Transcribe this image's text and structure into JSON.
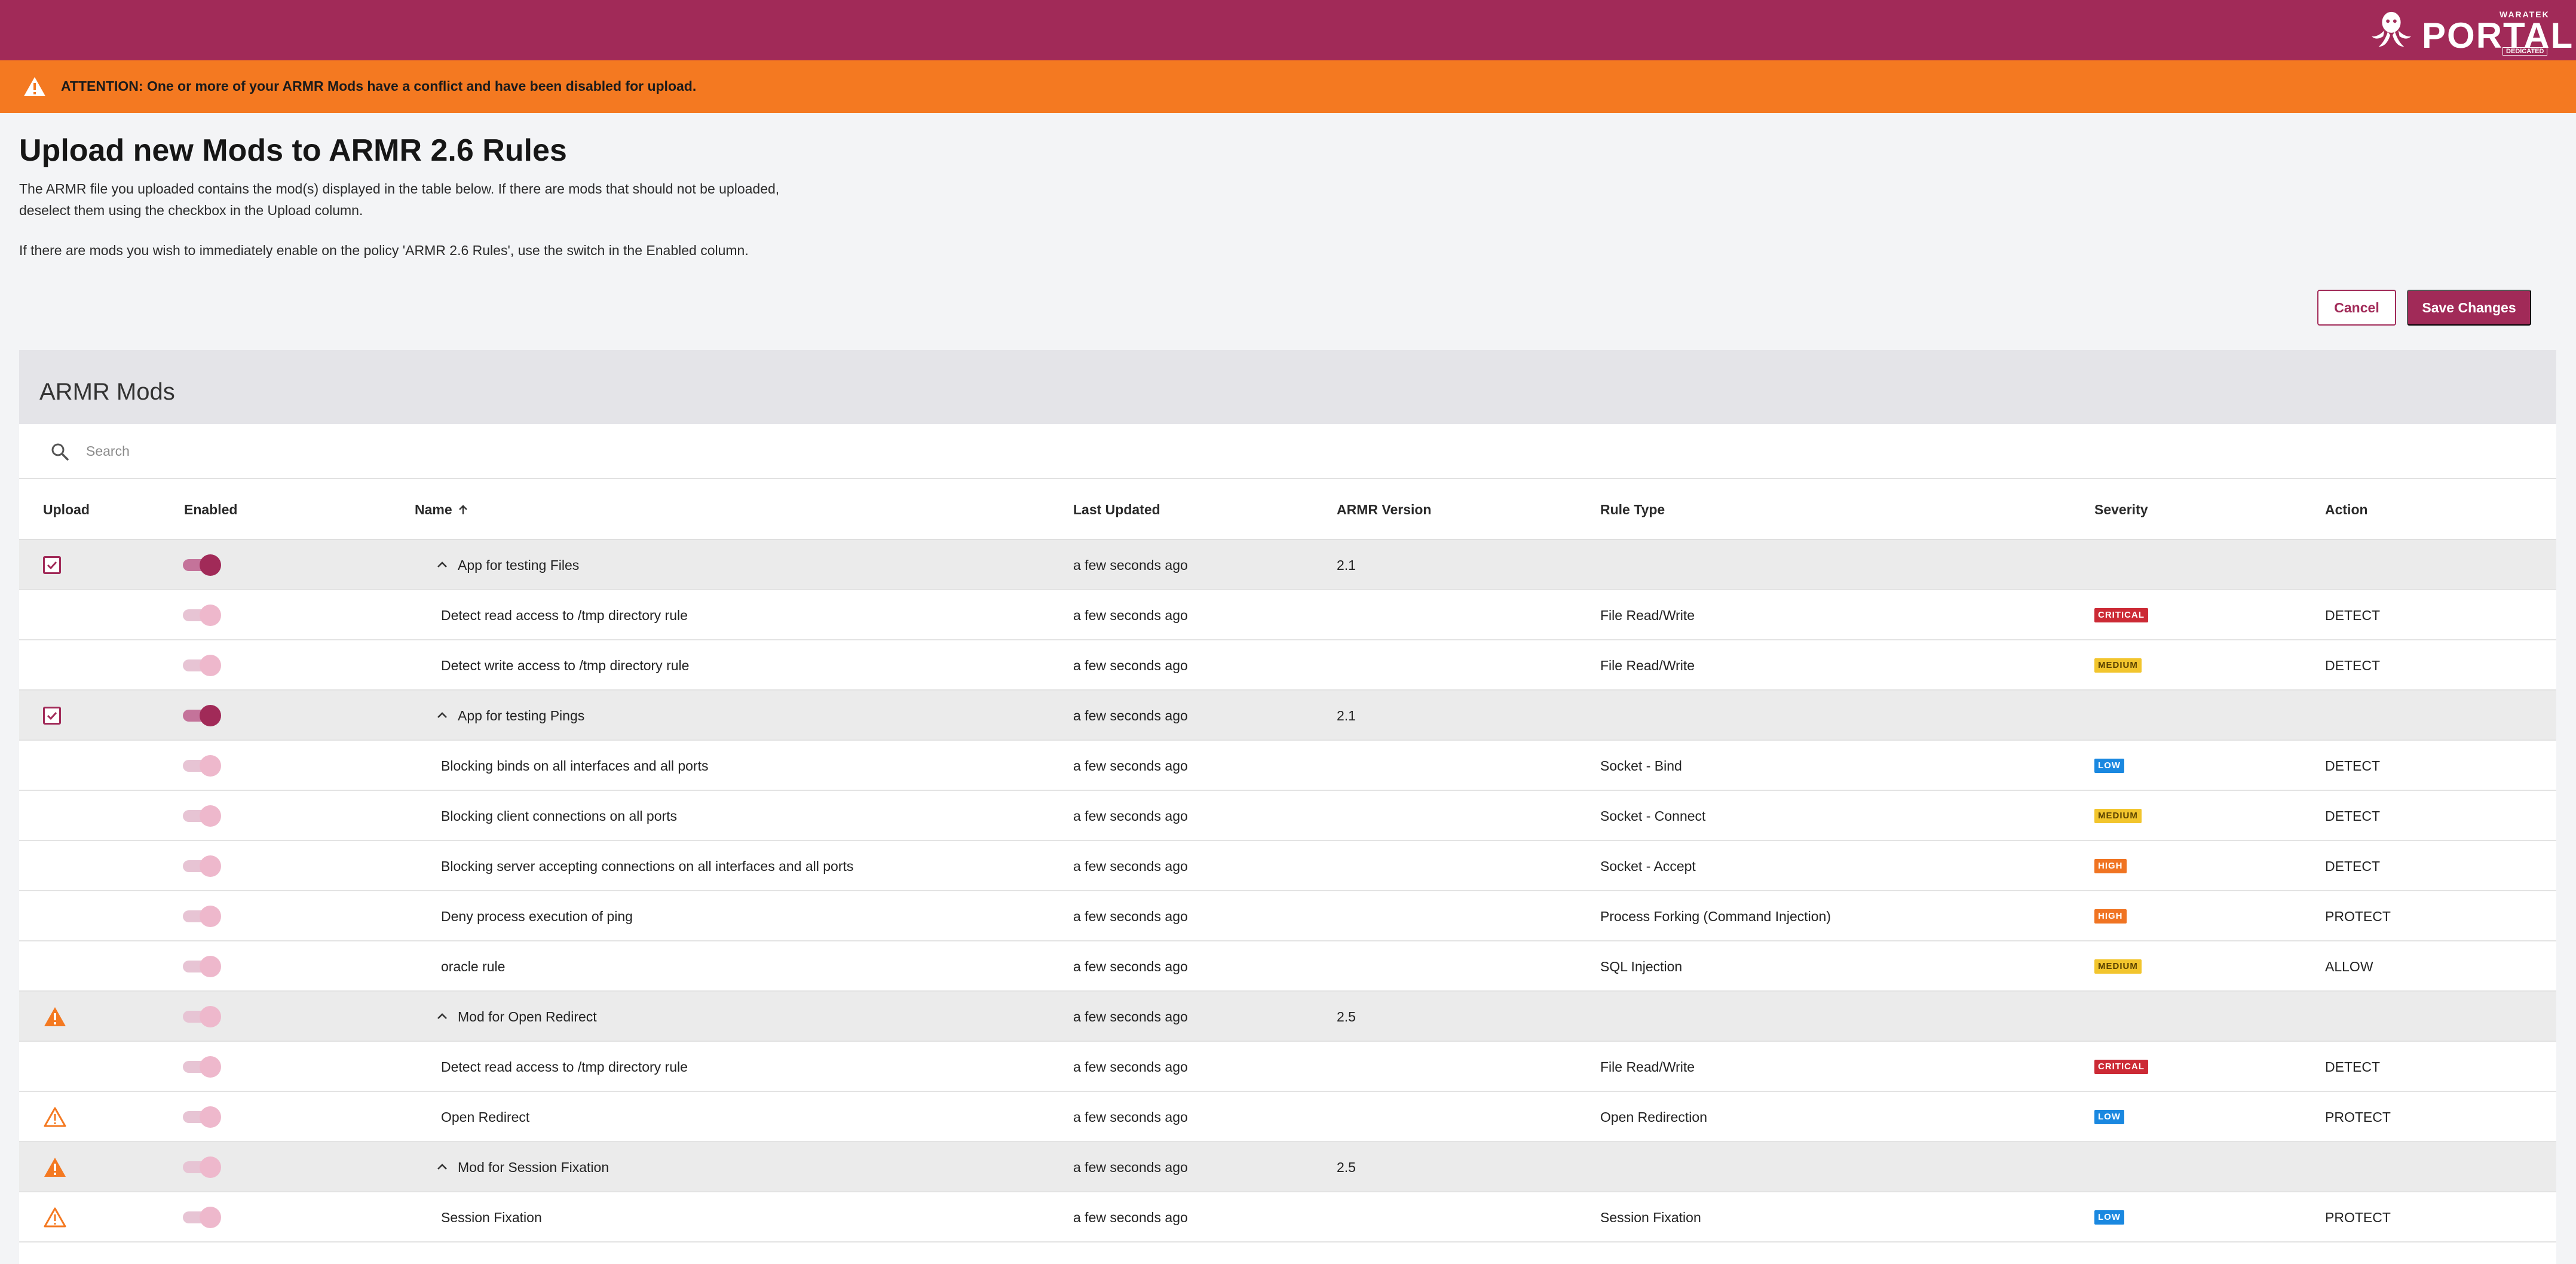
{
  "brand": {
    "small": "WARATEK",
    "big": "PORTAL",
    "tag": "DEDICATED"
  },
  "alert": {
    "text": "ATTENTION: One or more of your ARMR Mods have a conflict and have been disabled for upload.",
    "icon": "warning-icon"
  },
  "page": {
    "title": "Upload new Mods to ARMR 2.6 Rules",
    "intro": "The ARMR file you uploaded contains the mod(s) displayed in the table below. If there are mods that should not be uploaded, deselect them using the checkbox in the Upload column.",
    "intro2": "If there are mods you wish to immediately enable on the policy 'ARMR 2.6 Rules', use the switch in the Enabled column."
  },
  "buttons": {
    "cancel": "Cancel",
    "save": "Save Changes"
  },
  "card": {
    "title": "ARMR Mods",
    "search_placeholder": "Search"
  },
  "columns": {
    "upload": "Upload",
    "enabled": "Enabled",
    "name": "Name",
    "last_updated": "Last Updated",
    "armr_version": "ARMR Version",
    "rule_type": "Rule Type",
    "severity": "Severity",
    "action": "Action"
  },
  "rows": [
    {
      "kind": "group",
      "upload": "checked",
      "enabled": true,
      "name": "App for testing Files",
      "last_updated": "a few seconds ago",
      "armr_version": "2.1",
      "rule_type": "",
      "severity": "",
      "action": ""
    },
    {
      "kind": "child",
      "upload": "",
      "enabled": false,
      "name": "Detect read access to /tmp directory rule",
      "last_updated": "a few seconds ago",
      "armr_version": "",
      "rule_type": "File Read/Write",
      "severity": "CRITICAL",
      "action": "DETECT"
    },
    {
      "kind": "child",
      "upload": "",
      "enabled": false,
      "name": "Detect write access to /tmp directory rule",
      "last_updated": "a few seconds ago",
      "armr_version": "",
      "rule_type": "File Read/Write",
      "severity": "MEDIUM",
      "action": "DETECT"
    },
    {
      "kind": "group",
      "upload": "checked",
      "enabled": true,
      "name": "App for testing Pings",
      "last_updated": "a few seconds ago",
      "armr_version": "2.1",
      "rule_type": "",
      "severity": "",
      "action": ""
    },
    {
      "kind": "child",
      "upload": "",
      "enabled": false,
      "name": "Blocking binds on all interfaces and all ports",
      "last_updated": "a few seconds ago",
      "armr_version": "",
      "rule_type": "Socket - Bind",
      "severity": "LOW",
      "action": "DETECT"
    },
    {
      "kind": "child",
      "upload": "",
      "enabled": false,
      "name": "Blocking client connections on all ports",
      "last_updated": "a few seconds ago",
      "armr_version": "",
      "rule_type": "Socket - Connect",
      "severity": "MEDIUM",
      "action": "DETECT"
    },
    {
      "kind": "child",
      "upload": "",
      "enabled": false,
      "name": "Blocking server accepting connections on all interfaces and all ports",
      "last_updated": "a few seconds ago",
      "armr_version": "",
      "rule_type": "Socket - Accept",
      "severity": "HIGH",
      "action": "DETECT"
    },
    {
      "kind": "child",
      "upload": "",
      "enabled": false,
      "name": "Deny process execution of ping",
      "last_updated": "a few seconds ago",
      "armr_version": "",
      "rule_type": "Process Forking (Command Injection)",
      "severity": "HIGH",
      "action": "PROTECT"
    },
    {
      "kind": "child",
      "upload": "",
      "enabled": false,
      "name": "oracle rule",
      "last_updated": "a few seconds ago",
      "armr_version": "",
      "rule_type": "SQL Injection",
      "severity": "MEDIUM",
      "action": "ALLOW"
    },
    {
      "kind": "group",
      "upload": "warning-filled",
      "enabled": false,
      "name": "Mod for Open Redirect",
      "last_updated": "a few seconds ago",
      "armr_version": "2.5",
      "rule_type": "",
      "severity": "",
      "action": ""
    },
    {
      "kind": "child",
      "upload": "",
      "enabled": false,
      "name": "Detect read access to /tmp directory rule",
      "last_updated": "a few seconds ago",
      "armr_version": "",
      "rule_type": "File Read/Write",
      "severity": "CRITICAL",
      "action": "DETECT"
    },
    {
      "kind": "child",
      "upload": "warning-outline",
      "enabled": false,
      "name": "Open Redirect",
      "last_updated": "a few seconds ago",
      "armr_version": "",
      "rule_type": "Open Redirection",
      "severity": "LOW",
      "action": "PROTECT"
    },
    {
      "kind": "group",
      "upload": "warning-filled",
      "enabled": false,
      "name": "Mod for Session Fixation",
      "last_updated": "a few seconds ago",
      "armr_version": "2.5",
      "rule_type": "",
      "severity": "",
      "action": ""
    },
    {
      "kind": "child",
      "upload": "warning-outline",
      "enabled": false,
      "name": "Session Fixation",
      "last_updated": "a few seconds ago",
      "armr_version": "",
      "rule_type": "Session Fixation",
      "severity": "LOW",
      "action": "PROTECT"
    }
  ],
  "colors": {
    "brand": "#a12a58",
    "alert": "#f47921",
    "critical": "#cc2a35",
    "medium": "#f2c52d",
    "low": "#1a88e0",
    "high": "#f07422"
  }
}
